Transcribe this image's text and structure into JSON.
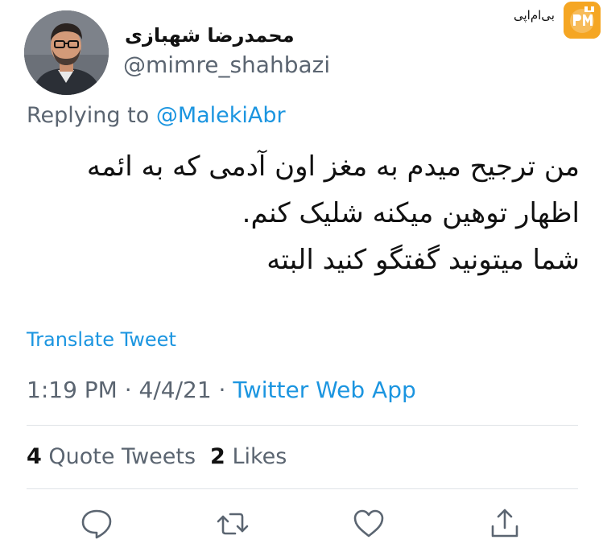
{
  "user": {
    "display_name": "محمدرضا شهبازی",
    "handle": "@mimre_shahbazi"
  },
  "watermark": {
    "text": "بی‌ام‌اپی",
    "badge": "PM UP"
  },
  "replying": {
    "prefix": "Replying to",
    "mention": "@MalekiAbr"
  },
  "tweet": {
    "lines": [
      "من ترجیح میدم به مغز اون آدمی که به ائمه",
      "اظهار توهین میکنه شلیک کنم.",
      "شما میتونید گفتگو کنید البته"
    ]
  },
  "translate_label": "Translate Tweet",
  "meta": {
    "time": "1:19 PM",
    "sep1": " · ",
    "date": "4/4/21",
    "sep2": " · ",
    "source": "Twitter Web App"
  },
  "stats": {
    "quote_count": "4",
    "quote_label": "Quote Tweets",
    "like_count": "2",
    "like_label": "Likes"
  },
  "icons": {
    "reply": "speech-bubble-icon",
    "retweet": "retweet-arrows-icon",
    "like": "heart-icon",
    "share": "share-upload-icon"
  },
  "colors": {
    "link": "#1b95e0",
    "secondary_text": "#5b6571",
    "icon": "#5b6571",
    "divider": "#dfe3e7",
    "badge": "#f5a623"
  }
}
